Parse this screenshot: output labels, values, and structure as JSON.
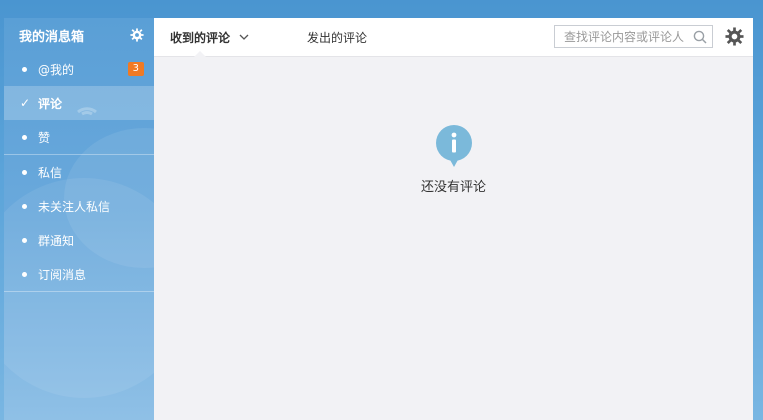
{
  "sidebar": {
    "title": "我的消息箱",
    "items": [
      {
        "label": "@我的",
        "badge": "3"
      },
      {
        "label": "评论"
      },
      {
        "label": "赞"
      },
      {
        "label": "私信"
      },
      {
        "label": "未关注人私信"
      },
      {
        "label": "群通知"
      },
      {
        "label": "订阅消息"
      }
    ]
  },
  "tabs": {
    "received": "收到的评论",
    "sent": "发出的评论"
  },
  "search": {
    "placeholder": "查找评论内容或评论人"
  },
  "empty": {
    "message": "还没有评论"
  },
  "colors": {
    "badge": "#f07a24",
    "info_icon": "#7bb9da"
  }
}
